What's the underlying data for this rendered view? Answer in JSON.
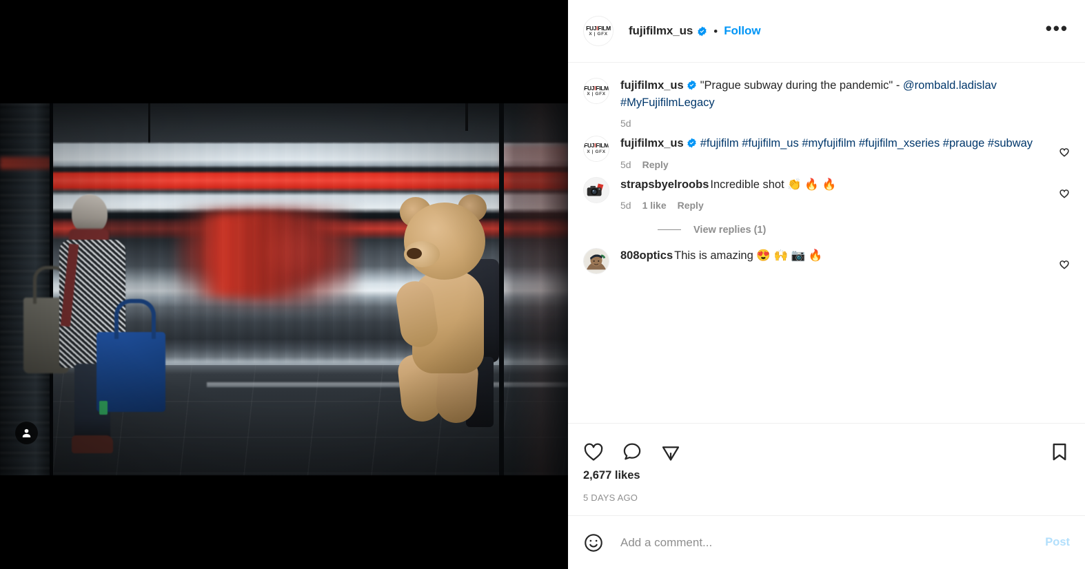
{
  "header": {
    "account": "fujifilmx_us",
    "verified_icon": "verified-badge-icon",
    "separator": "•",
    "follow_label": "Follow",
    "more_label": "•••",
    "avatar_logo_top": "FUJIFILM",
    "avatar_logo_top_accent": "i",
    "avatar_logo_bottom": "X | GFX"
  },
  "caption": {
    "account": "fujifilmx_us",
    "text": "\"Prague subway during the pandemic\" -",
    "mention": "@rombald.ladislav",
    "hashtag": "#MyFujifilmLegacy",
    "time": "5d"
  },
  "comments": [
    {
      "account": "fujifilmx_us",
      "verified": true,
      "text": "#fujifilm #fujifilm_us #myfujifilm #fujifilm_xseries #prauge #subway",
      "hashtags_line1": "#fujifilm #fujifilm_us #myfujifilm",
      "hashtags_line2": "#fujifilm_xseries #prauge #subway",
      "time": "5d",
      "likes": "",
      "reply_label": "Reply",
      "avatar_type": "fujifilm-logo"
    },
    {
      "account": "strapsbyelroobs",
      "verified": false,
      "text": "Incredible shot 👏 🔥 🔥",
      "body": "Incredible shot",
      "emojis": "👏 🔥 🔥",
      "time": "5d",
      "likes": "1 like",
      "reply_label": "Reply",
      "avatar_type": "camera-photo",
      "view_replies_label": "View replies (1)"
    },
    {
      "account": "808optics",
      "verified": false,
      "text": "This is amazing 😍 🙌 📷 🔥",
      "body": "This is amazing",
      "emojis": "😍 🙌 📷 🔥",
      "avatar_type": "person-photo"
    }
  ],
  "actions": {
    "like_icon": "heart-icon",
    "comment_icon": "speech-bubble-icon",
    "share_icon": "paper-plane-icon",
    "save_icon": "bookmark-icon",
    "likes_count": "2,677 likes",
    "posted_ago": "5 DAYS AGO"
  },
  "add_comment": {
    "emoji_icon": "smiley-face-icon",
    "placeholder": "Add a comment...",
    "post_label": "Post"
  },
  "media": {
    "alt": "Motion-blurred red and white subway train passing a station platform; a woman with bags stands at left and a person carries a large teddy bear at right",
    "tagged_users_icon": "tagged-users-icon"
  },
  "colors": {
    "instagram_blue": "#0095f6",
    "link_blue": "#00376b",
    "text_primary": "#262626",
    "text_muted": "#8e8e8e",
    "post_disabled": "#b2dffc"
  }
}
